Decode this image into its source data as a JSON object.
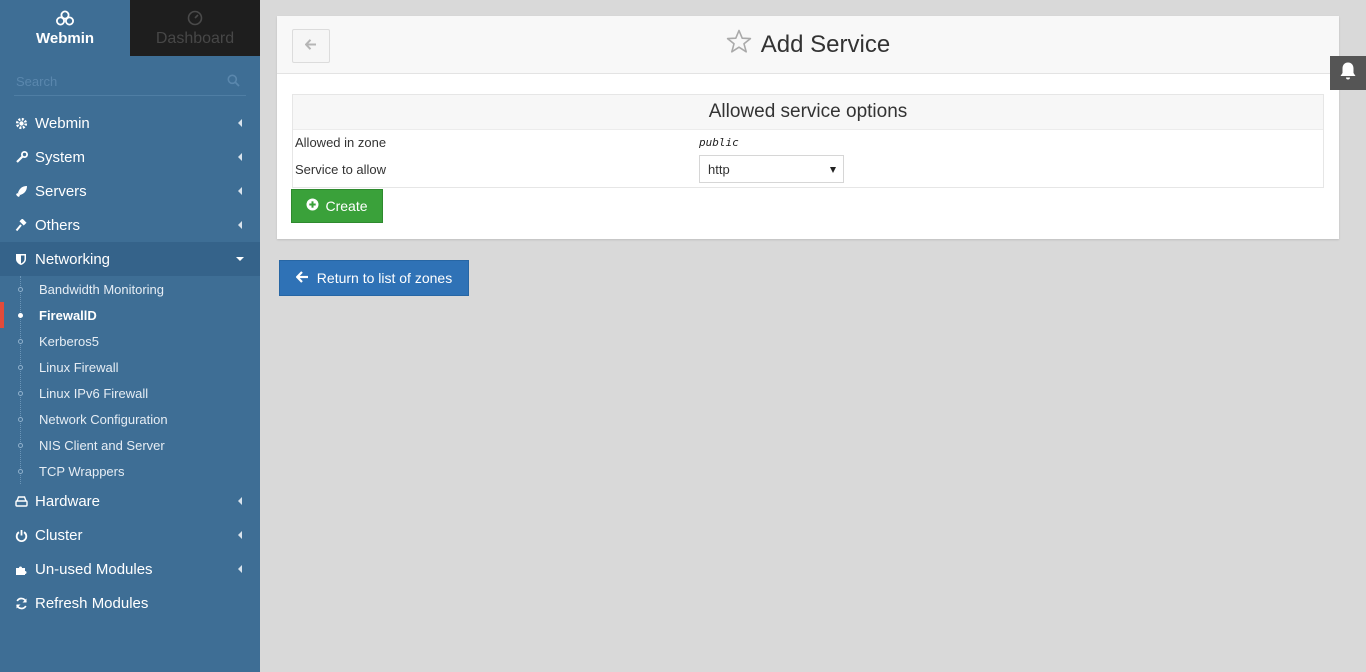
{
  "sidebar": {
    "tabs": [
      {
        "label": "Webmin",
        "icon": "webmin-logo-icon"
      },
      {
        "label": "Dashboard",
        "icon": "dashboard-icon"
      }
    ],
    "search": {
      "placeholder": "Search",
      "value": ""
    },
    "menu": [
      {
        "label": "Webmin",
        "icon": "gear-icon"
      },
      {
        "label": "System",
        "icon": "wrench-icon"
      },
      {
        "label": "Servers",
        "icon": "rocket-icon"
      },
      {
        "label": "Others",
        "icon": "gavel-icon"
      },
      {
        "label": "Networking",
        "icon": "shield-icon"
      }
    ],
    "submenu": [
      {
        "label": "Bandwidth Monitoring"
      },
      {
        "label": "FirewallD"
      },
      {
        "label": "Kerberos5"
      },
      {
        "label": "Linux Firewall"
      },
      {
        "label": "Linux IPv6 Firewall"
      },
      {
        "label": "Network Configuration"
      },
      {
        "label": "NIS Client and Server"
      },
      {
        "label": "TCP Wrappers"
      }
    ],
    "menu_bottom": [
      {
        "label": "Hardware",
        "icon": "hdd-icon"
      },
      {
        "label": "Cluster",
        "icon": "power-icon"
      },
      {
        "label": "Un-used Modules",
        "icon": "puzzle-icon"
      },
      {
        "label": "Refresh Modules",
        "icon": "refresh-icon"
      }
    ],
    "active_submenu": "FirewallD"
  },
  "main": {
    "title": "Add Service",
    "section_title": "Allowed service options",
    "fields": {
      "zone_label": "Allowed in zone",
      "zone_value": "public",
      "service_label": "Service to allow",
      "service_value": "http"
    },
    "create_label": "Create",
    "return_label": "Return to list of zones"
  },
  "colors": {
    "sidebar": "#3e6e95",
    "active_marker": "#e14b3b",
    "create_button": "#3aa13a",
    "return_button": "#2f72b6"
  }
}
